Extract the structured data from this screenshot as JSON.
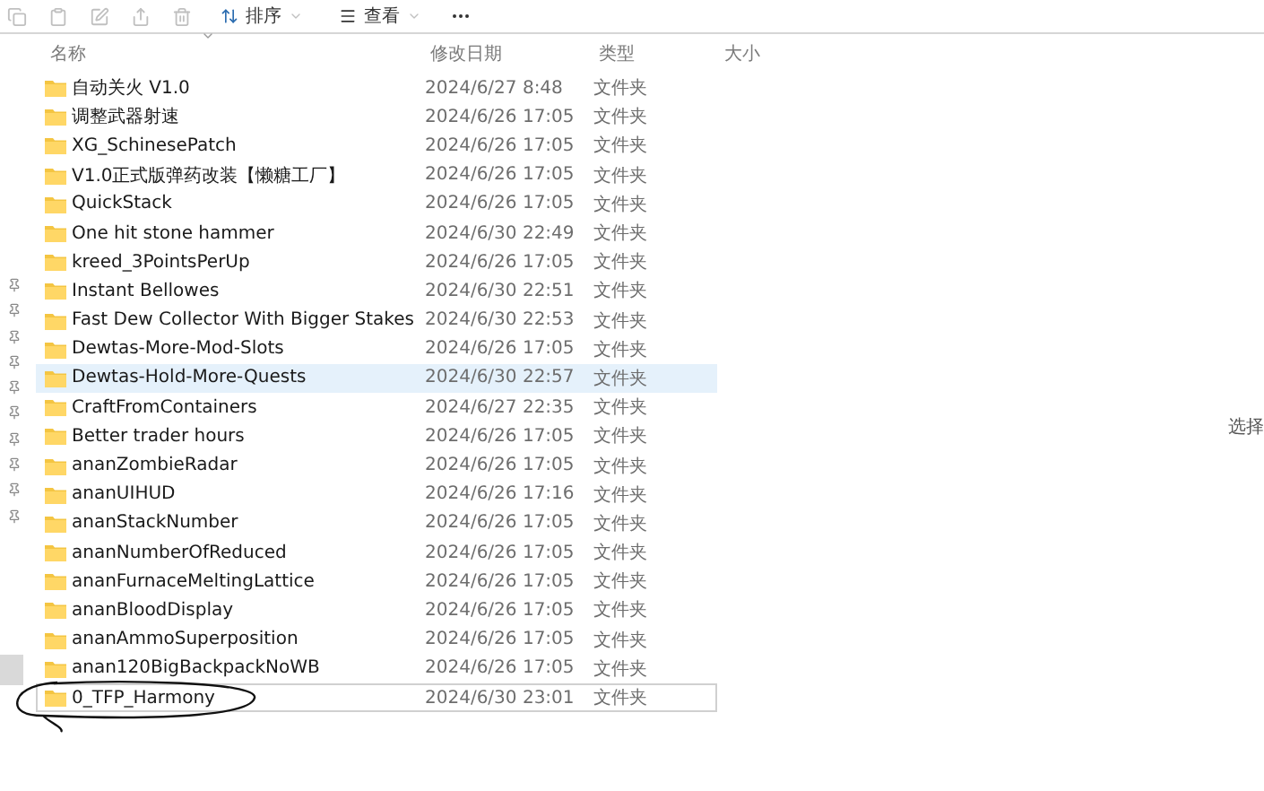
{
  "toolbar": {
    "sort": "排序",
    "view": "查看"
  },
  "columns": [
    "名称",
    "修改日期",
    "类型",
    "大小"
  ],
  "rows": [
    {
      "name": "自动关火 V1.0",
      "date": "2024/6/27 8:48",
      "type": "文件夹",
      "selected": false,
      "focused": false
    },
    {
      "name": "调整武器射速",
      "date": "2024/6/26 17:05",
      "type": "文件夹",
      "selected": false,
      "focused": false
    },
    {
      "name": "XG_SchinesePatch",
      "date": "2024/6/26 17:05",
      "type": "文件夹",
      "selected": false,
      "focused": false
    },
    {
      "name": "V1.0正式版弹药改装【懒糖工厂】",
      "date": "2024/6/26 17:05",
      "type": "文件夹",
      "selected": false,
      "focused": false
    },
    {
      "name": "QuickStack",
      "date": "2024/6/26 17:05",
      "type": "文件夹",
      "selected": false,
      "focused": false
    },
    {
      "name": "One hit stone hammer",
      "date": "2024/6/30 22:49",
      "type": "文件夹",
      "selected": false,
      "focused": false
    },
    {
      "name": "kreed_3PointsPerUp",
      "date": "2024/6/26 17:05",
      "type": "文件夹",
      "selected": false,
      "focused": false
    },
    {
      "name": "Instant Bellowes",
      "date": "2024/6/30 22:51",
      "type": "文件夹",
      "selected": false,
      "focused": false
    },
    {
      "name": "Fast Dew Collector With Bigger Stakes",
      "date": "2024/6/30 22:53",
      "type": "文件夹",
      "selected": false,
      "focused": false
    },
    {
      "name": "Dewtas-More-Mod-Slots",
      "date": "2024/6/26 17:05",
      "type": "文件夹",
      "selected": false,
      "focused": false
    },
    {
      "name": "Dewtas-Hold-More-Quests",
      "date": "2024/6/30 22:57",
      "type": "文件夹",
      "selected": true,
      "focused": false
    },
    {
      "name": "CraftFromContainers",
      "date": "2024/6/27 22:35",
      "type": "文件夹",
      "selected": false,
      "focused": false
    },
    {
      "name": "Better trader hours",
      "date": "2024/6/26 17:05",
      "type": "文件夹",
      "selected": false,
      "focused": false
    },
    {
      "name": "ananZombieRadar",
      "date": "2024/6/26 17:05",
      "type": "文件夹",
      "selected": false,
      "focused": false
    },
    {
      "name": "ananUIHUD",
      "date": "2024/6/26 17:16",
      "type": "文件夹",
      "selected": false,
      "focused": false
    },
    {
      "name": "ananStackNumber",
      "date": "2024/6/26 17:05",
      "type": "文件夹",
      "selected": false,
      "focused": false
    },
    {
      "name": "ananNumberOfReduced",
      "date": "2024/6/26 17:05",
      "type": "文件夹",
      "selected": false,
      "focused": false
    },
    {
      "name": "ananFurnaceMeltingLattice",
      "date": "2024/6/26 17:05",
      "type": "文件夹",
      "selected": false,
      "focused": false
    },
    {
      "name": "ananBloodDisplay",
      "date": "2024/6/26 17:05",
      "type": "文件夹",
      "selected": false,
      "focused": false
    },
    {
      "name": "ananAmmoSuperposition",
      "date": "2024/6/26 17:05",
      "type": "文件夹",
      "selected": false,
      "focused": false
    },
    {
      "name": "anan120BigBackpackNoWB",
      "date": "2024/6/26 17:05",
      "type": "文件夹",
      "selected": false,
      "focused": false
    },
    {
      "name": "0_TFP_Harmony",
      "date": "2024/6/30 23:01",
      "type": "文件夹",
      "selected": false,
      "focused": true
    }
  ],
  "details_pane": {
    "text": "选择"
  }
}
